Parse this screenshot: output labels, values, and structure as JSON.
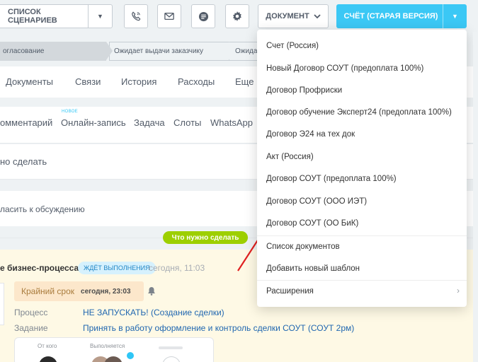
{
  "toolbar": {
    "scenarios_label": "СПИСОК СЦЕНАРИЕВ",
    "document_label": "ДОКУМЕНТ",
    "invoice_label": "СЧЁТ (СТАРАЯ ВЕРСИЯ)"
  },
  "stages": [
    "огласование",
    "Ожидает выдачи заказчику",
    "Ожида"
  ],
  "tabs": [
    "Документы",
    "Связи",
    "История",
    "Расходы",
    "Еще"
  ],
  "composer": {
    "new_badge": "НОВОЕ",
    "tabs": [
      "омментарий",
      "Онлайн-запись",
      "Задача",
      "Слоты",
      "WhatsApp"
    ],
    "todo_placeholder": "но сделать",
    "discuss_text": "ласить к обсуждению"
  },
  "section_pill": "Что нужно сделать",
  "activity": {
    "title": "е бизнес-процесса",
    "status_badge": "ЖДЁТ ВЫПОЛНЕНИЯ",
    "time": "сегодня, 11:03",
    "deadline_label": "Крайний срок",
    "deadline_value": "сегодня, 23:03",
    "process_label": "Процесс",
    "process_value": "НЕ ЗАПУСКАТЬ! (Создание сделки)",
    "task_label": "Задание",
    "task_value": "Принять в работу оформление и контроль сделки СОУТ (СОУТ 2рм)",
    "from_label": "От кого",
    "executor_label": "Выполняется"
  },
  "menu": {
    "items": [
      "Счет (Россия)",
      "Новый Договор СОУТ (предоплата 100%)",
      "Договор Профриски",
      "Договор обучение Эксперт24 (предоплата 100%)",
      "Договор Э24 на тех док",
      "Акт (Россия)",
      "Договор СОУТ (предоплата 100%)",
      "Договор СОУТ (ООО ИЭТ)",
      "Договор СОУТ (ОО БиК)"
    ],
    "list_label": "Список документов",
    "add_template_label": "Добавить новый шаблон",
    "extensions_label": "Расширения"
  },
  "colors": {
    "accent_blue": "#3bc8f5",
    "pill_green": "#9dcf00",
    "annotation_red": "#e02020"
  }
}
